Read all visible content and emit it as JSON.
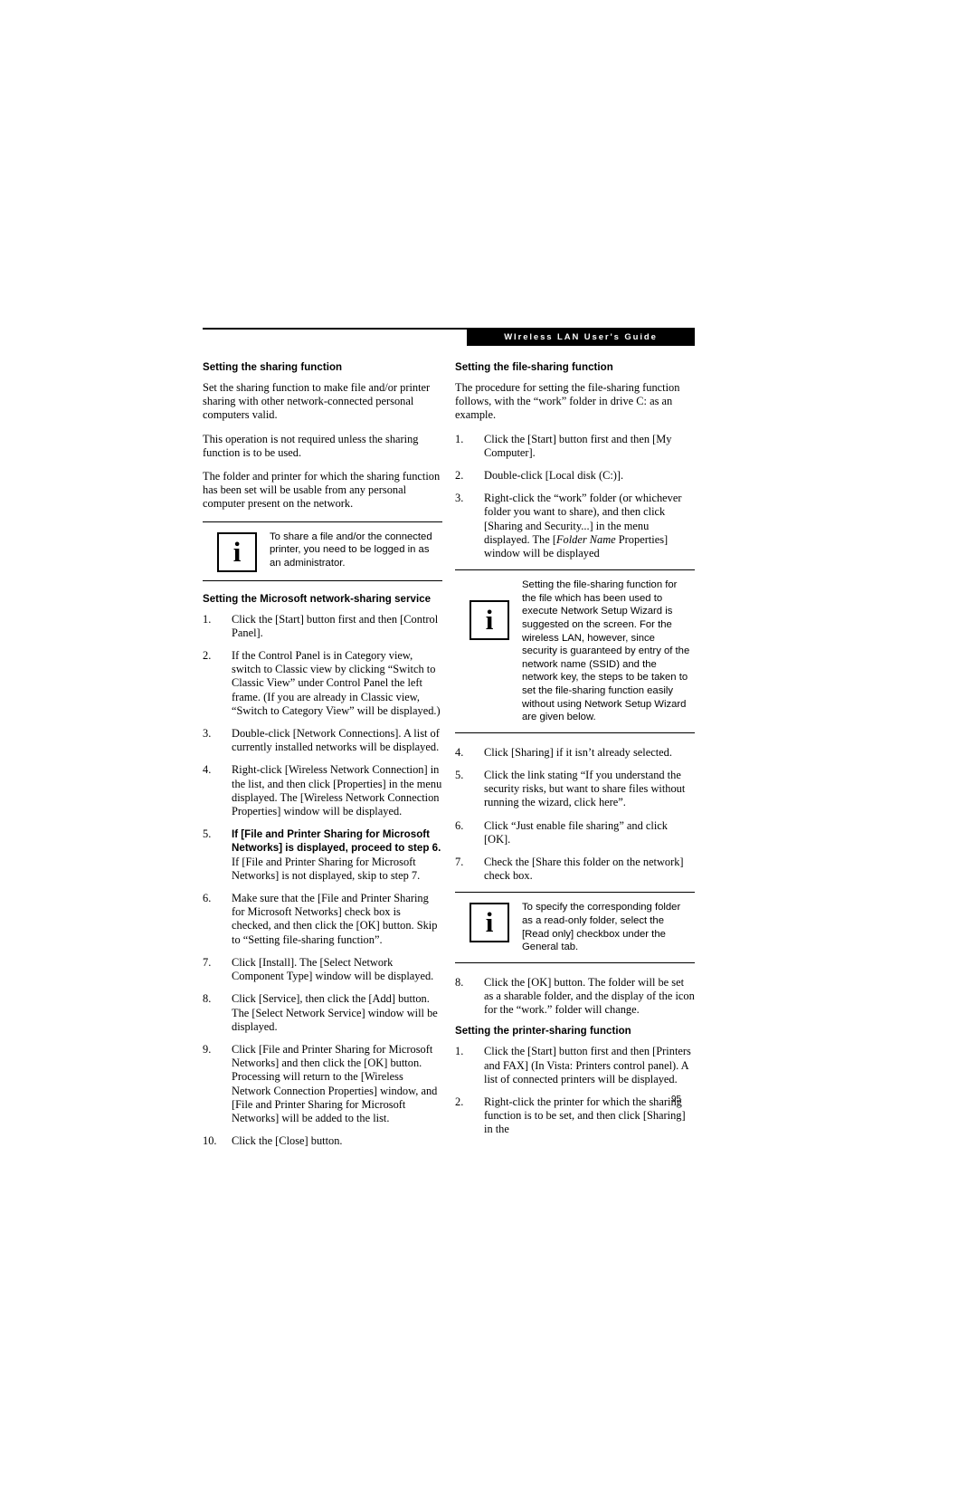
{
  "header": {
    "running_title": "WIreless LAN User's Guide"
  },
  "page_number": "95",
  "left_column": {
    "section1": {
      "heading": "Setting the sharing function",
      "paragraphs": [
        "Set the sharing function to make file and/or printer sharing with other network-connected personal computers valid.",
        "This operation is not required unless the sharing function is to be used.",
        "The folder and printer for which the sharing function has been set will be usable from any personal computer present on the network."
      ],
      "note": {
        "icon": "information-icon",
        "text": "To share a file and/or the connected printer, you need to be logged in as an administrator."
      }
    },
    "section2": {
      "heading": "Setting the Microsoft network-sharing service",
      "steps": [
        {
          "num": "1.",
          "text": "Click the [Start] button first and then [Control Panel]."
        },
        {
          "num": "2.",
          "text": "If the Control Panel is in Category view, switch to Classic view by clicking “Switch to Classic View” under Control Panel the left frame. (If you are already in Classic view, “Switch to Category View” will be displayed.)"
        },
        {
          "num": "3.",
          "text": "Double-click [Network Connections]. A list of currently installed networks will be displayed."
        },
        {
          "num": "4.",
          "text": "Right-click [Wireless Network Connection] in the list, and then click [Properties] in the menu displayed. The [Wireless Network Connection Properties] window will be displayed."
        },
        {
          "num": "5.",
          "bold_text": "If [File and Printer Sharing for Microsoft Networks] is displayed, proceed to step 6.",
          "text": " If [File and Printer Sharing for Microsoft Networks] is not displayed, skip to step 7."
        },
        {
          "num": "6.",
          "text": "Make sure that the [File and Printer Sharing for Microsoft Networks] check box is checked, and then click the [OK] button. Skip to “Setting file-sharing function”."
        },
        {
          "num": "7.",
          "text": "Click [Install]. The [Select Network Component Type] window will be displayed."
        },
        {
          "num": "8.",
          "text": "Click [Service], then click the [Add] button. The [Select Network Service] window will be displayed."
        },
        {
          "num": "9.",
          "text": "Click [File and Printer Sharing for Microsoft Networks] and then click the [OK] button. Processing will return to the [Wireless Network Connection Properties] window, and [File and Printer Sharing for Microsoft Networks] will be added to the list."
        },
        {
          "num": "10.",
          "text": "Click the [Close] button."
        }
      ]
    }
  },
  "right_column": {
    "section1": {
      "heading": "Setting the file-sharing function",
      "intro": "The procedure for setting the file-sharing function follows, with the “work” folder in drive C: as an example.",
      "steps_before_note": [
        {
          "num": "1.",
          "text": "Click the [Start] button first and then [My Computer]."
        },
        {
          "num": "2.",
          "text": "Double-click [Local disk (C:)]."
        },
        {
          "num": "3.",
          "text": "Right-click the “work” folder (or whichever folder you want to share), and then click [Sharing and Security...] in the menu displayed. The [",
          "italic_text": "Folder Name",
          "text_tail": " Properties] window will be displayed"
        }
      ],
      "note1": {
        "icon": "information-icon",
        "text": "Setting the file-sharing function for the file which has been used to execute Network Setup Wizard is suggested on the screen. For the wireless LAN, however, since security is guaranteed by entry of the network name (SSID) and the network key, the steps to be taken to set the file-sharing function easily without using Network Setup Wizard are given below."
      },
      "steps_after_note": [
        {
          "num": "4.",
          "text": "Click [Sharing] if it isn’t already selected."
        },
        {
          "num": "5.",
          "text": "Click the link stating “If you understand the security risks, but want to share files without running the wizard, click here”."
        },
        {
          "num": "6.",
          "text": "Click “Just enable file sharing” and click [OK]."
        },
        {
          "num": "7.",
          "text": "Check the [Share this folder on the network] check box."
        }
      ],
      "note2": {
        "icon": "information-icon",
        "text": "To specify the corresponding folder as a read-only folder, select the [Read only] checkbox under the General tab."
      },
      "steps_final": [
        {
          "num": "8.",
          "text": "Click the [OK] button. The folder will be set as a sharable folder, and the display of the icon for the “work.” folder will change."
        }
      ]
    },
    "section2": {
      "heading": "Setting the printer-sharing function",
      "steps": [
        {
          "num": "1.",
          "text": "Click the [Start] button first and then [Printers and FAX] (In Vista: Printers control panel). A list of connected printers will be displayed."
        },
        {
          "num": "2.",
          "text": "Right-click the printer for which the sharing function is to be set, and then click [Sharing] in the"
        }
      ]
    }
  }
}
